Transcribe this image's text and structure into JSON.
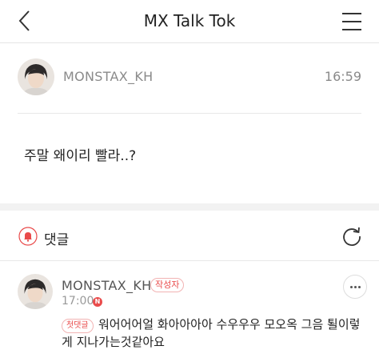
{
  "header": {
    "title": "MX Talk Tok",
    "back_icon": "chevron-left-icon",
    "menu_icon": "hamburger-menu-icon"
  },
  "post": {
    "username": "MONSTAX_KH",
    "time": "16:59",
    "body": "주말 왜이리 빨라..?"
  },
  "comments": {
    "label": "댓글",
    "bell_icon": "bell-icon",
    "refresh_icon": "refresh-icon",
    "items": [
      {
        "username": "MONSTAX_KH",
        "writer_badge": "작성자",
        "time": "17:00",
        "new_badge": "N",
        "first_badge": "첫댓글",
        "text": "워어어어얼 화아아아아 수우우우 모오옥 그음 퇼이렇게 지나가는것같아요"
      }
    ]
  },
  "colors": {
    "accent": "#e94b4b",
    "muted_text": "#8a8a8a",
    "divider": "#e8e8e8"
  }
}
